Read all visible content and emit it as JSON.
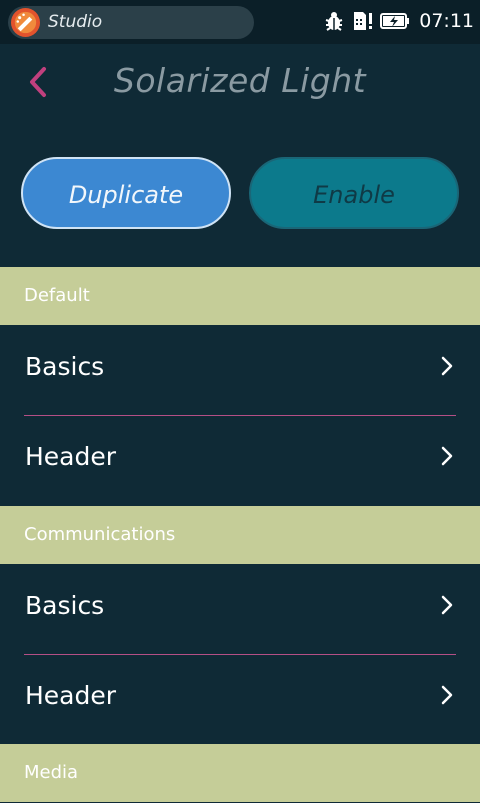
{
  "status_bar": {
    "app_name": "Studio",
    "time": "07:11",
    "icons": [
      "studio-app-icon",
      "bug-icon",
      "sim-signal-icon",
      "battery-charging-icon"
    ]
  },
  "header": {
    "title": "Solarized Light",
    "back_icon": "chevron-left-icon"
  },
  "actions": {
    "duplicate_label": "Duplicate",
    "enable_label": "Enable"
  },
  "sections": [
    {
      "title": "Default",
      "items": [
        {
          "label": "Basics"
        },
        {
          "label": "Header"
        }
      ]
    },
    {
      "title": "Communications",
      "items": [
        {
          "label": "Basics"
        },
        {
          "label": "Header"
        }
      ]
    },
    {
      "title": "Media",
      "items": []
    }
  ],
  "colors": {
    "background": "#0f2a36",
    "status_bar": "#0b1f28",
    "section_header": "#c5cd98",
    "divider": "#b44f86",
    "back_chevron": "#c0407e",
    "duplicate_button": "#3c88d2",
    "enable_button": "#0c7a8c"
  }
}
